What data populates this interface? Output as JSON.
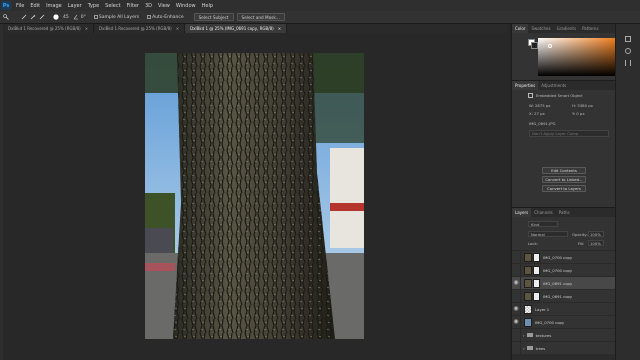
{
  "menubar": {
    "logo": "Ps",
    "items": [
      "File",
      "Edit",
      "Image",
      "Layer",
      "Type",
      "Select",
      "Filter",
      "3D",
      "View",
      "Window",
      "Help"
    ]
  },
  "options": {
    "size": "45",
    "angle": "0°",
    "sample_all_layers": "Sample All Layers",
    "auto_enhance": "Auto-Enhance",
    "select_subject": "Select Subject",
    "select_mask": "Select and Mask..."
  },
  "doc_tabs": [
    "DxlBkd 1 Recovered @ 25% (RGB/8)",
    "DxlBkd 1 Recovered @ 25% (RGB/8)",
    "DxlBkd 1 @ 25% (IMG_0691 copy, RGB/8)"
  ],
  "color_panel": {
    "tabs": [
      "Color",
      "Swatches",
      "Gradients",
      "Patterns"
    ],
    "accent": "#f07b18"
  },
  "properties": {
    "tabs": [
      "Properties",
      "Adjustments"
    ],
    "type": "Embedded Smart Object",
    "w": "W: 2875 px",
    "h": "H: 5380 px",
    "x": "X: 27 px",
    "y": "Y: 0 px",
    "source": "IMG_0691.JPG",
    "placeholder": "Don't Apply Layer Comp",
    "edit_contents": "Edit Contents",
    "convert_linked": "Convert to Linked...",
    "convert_layers": "Convert to Layers"
  },
  "layers": {
    "tabs": [
      "Layers",
      "Channels",
      "Paths"
    ],
    "filter": "Kind",
    "blend": "Normal",
    "opacity_label": "Opacity:",
    "opacity": "100%",
    "lock_label": "Lock:",
    "fill_label": "Fill:",
    "fill": "100%",
    "rows": [
      {
        "name": "IMG_0700 copy",
        "visible": false
      },
      {
        "name": "IMG_0700 copy",
        "visible": false
      },
      {
        "name": "IMG_0691 copy",
        "visible": true
      },
      {
        "name": "IMG_0691 copy",
        "visible": false
      },
      {
        "name": "Layer 1",
        "visible": true
      },
      {
        "name": "IMG_0700 copy",
        "visible": true
      },
      {
        "name": "textures",
        "visible": false
      },
      {
        "name": "trees",
        "visible": false
      }
    ]
  }
}
